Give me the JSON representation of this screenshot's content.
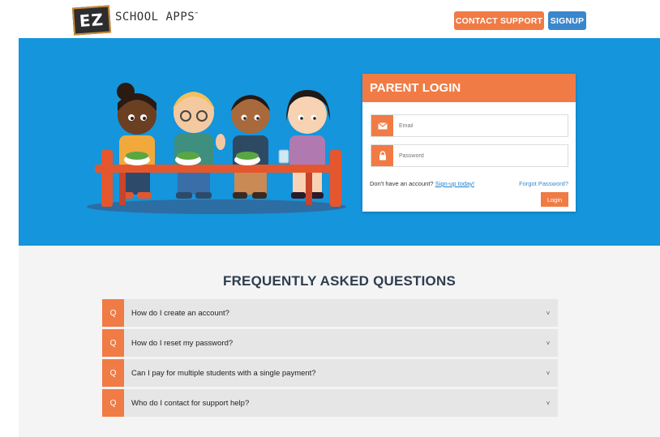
{
  "header": {
    "logo_mark": "EZ",
    "logo_text": "SCHOOL APPS",
    "logo_tm": "™",
    "contact_label": "CONTACT SUPPORT",
    "signup_label": "SIGNUP"
  },
  "login": {
    "title": "PARENT LOGIN",
    "email_placeholder": "Email",
    "password_placeholder": "Password",
    "no_account_text": "Don't have an account?",
    "signup_link": "Sign-up today!",
    "forgot_link": "Forgot Password?",
    "login_button": "Login"
  },
  "faq": {
    "title": "FREQUENTLY ASKED QUESTIONS",
    "q_marker": "Q",
    "chevron": "˅",
    "items": [
      {
        "question": "How do I create an account?"
      },
      {
        "question": "How do I reset my password?"
      },
      {
        "question": "Can I pay for multiple students with a single payment?"
      },
      {
        "question": "Who do I contact for support help?"
      }
    ]
  },
  "colors": {
    "accent_orange": "#f07b45",
    "signup_blue": "#3a87cd",
    "hero_blue": "#1495dc",
    "faq_bg": "#f4f4f4"
  },
  "icons": [
    "envelope-icon",
    "lock-icon",
    "chevron-down-icon"
  ]
}
